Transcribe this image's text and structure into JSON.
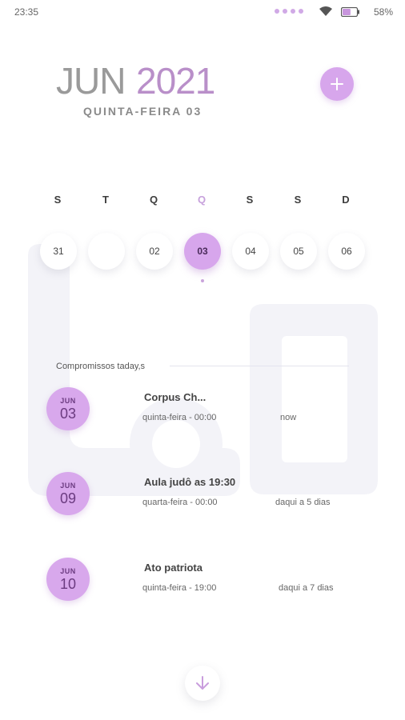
{
  "status_bar": {
    "time": "23:35",
    "battery_percent": "58%",
    "battery_level": 0.58,
    "notification_dot_color": "#d0a9e6"
  },
  "header": {
    "month": "JUN",
    "year": "2021",
    "weekday_date": "QUINTA-FEIRA 03",
    "add_icon": "plus-icon",
    "accent_color": "#d7a6ec"
  },
  "week": {
    "letters": [
      "S",
      "T",
      "Q",
      "Q",
      "S",
      "S",
      "D"
    ],
    "dates": [
      "31",
      "",
      "02",
      "03",
      "04",
      "05",
      "06"
    ],
    "active_index": 3
  },
  "events": {
    "title": "Compromissos taday,s",
    "items": [
      {
        "month": "JUN",
        "day": "03",
        "title": "Corpus Ch...",
        "time": "quinta-feira - 00:00",
        "relative": "now"
      },
      {
        "month": "JUN",
        "day": "09",
        "title": "Aula judô as 19:30",
        "time": "quarta-feira - 00:00",
        "relative": "daqui a 5 dias"
      },
      {
        "month": "JUN",
        "day": "10",
        "title": "Ato patriota",
        "time": "quinta-feira - 19:00",
        "relative": "daqui a 7 dias"
      }
    ]
  },
  "footer": {
    "scroll_icon": "arrow-down-icon"
  }
}
